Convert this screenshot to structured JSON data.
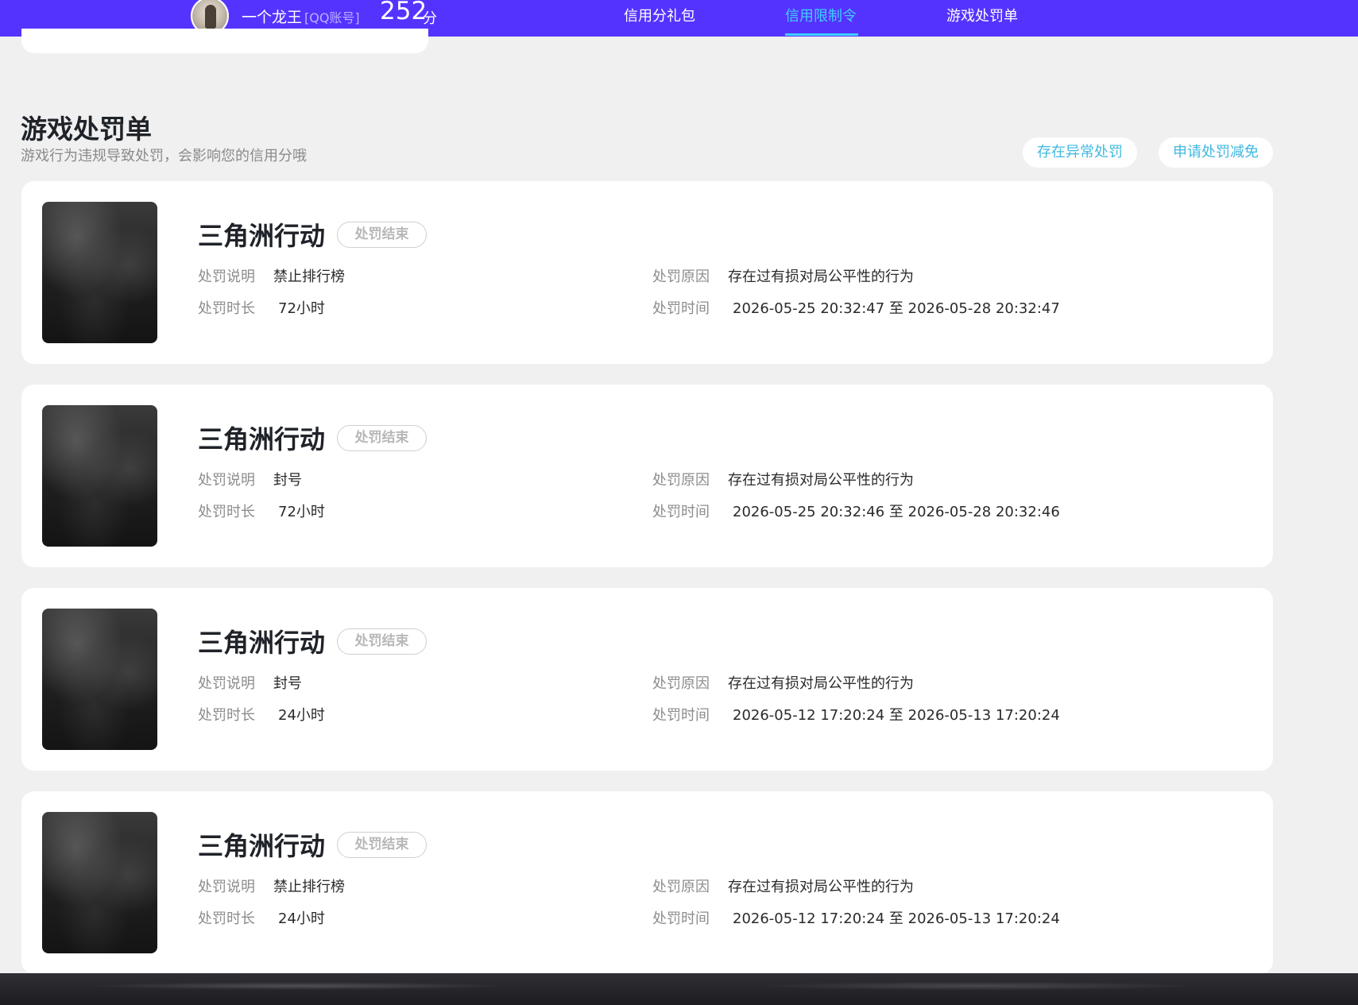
{
  "header": {
    "nickname": "一个龙王",
    "account_type": "[QQ账号]",
    "score": "252",
    "score_unit": "分",
    "tabs": [
      {
        "label": "信用分礼包",
        "active": false
      },
      {
        "label": "信用限制令",
        "active": true
      },
      {
        "label": "游戏处罚单",
        "active": false
      }
    ],
    "active_color": "#3fd0ff",
    "bar_color": "#5533ff"
  },
  "section": {
    "title": "游戏处罚单",
    "subtitle": "游戏行为违规导致处罚，会影响您的信用分哦",
    "buttons": {
      "abnormal": "存在异常处罚",
      "reduce": "申请处罚减免"
    }
  },
  "labels": {
    "description": "处罚说明",
    "duration": "处罚时长",
    "reason": "处罚原因",
    "time": "处罚时间"
  },
  "records": [
    {
      "game": "三角洲行动",
      "status": "处罚结束",
      "description": "禁止排行榜",
      "duration": "72小时",
      "reason": "存在过有损对局公平性的行为",
      "time": "2026-05-25 20:32:47 至 2026-05-28 20:32:47"
    },
    {
      "game": "三角洲行动",
      "status": "处罚结束",
      "description": "封号",
      "duration": "72小时",
      "reason": "存在过有损对局公平性的行为",
      "time": "2026-05-25 20:32:46 至 2026-05-28 20:32:46"
    },
    {
      "game": "三角洲行动",
      "status": "处罚结束",
      "description": "封号",
      "duration": "24小时",
      "reason": "存在过有损对局公平性的行为",
      "time": "2026-05-12 17:20:24 至 2026-05-13 17:20:24"
    },
    {
      "game": "三角洲行动",
      "status": "处罚结束",
      "description": "禁止排行榜",
      "duration": "24小时",
      "reason": "存在过有损对局公平性的行为",
      "time": "2026-05-12 17:20:24 至 2026-05-13 17:20:24"
    }
  ]
}
